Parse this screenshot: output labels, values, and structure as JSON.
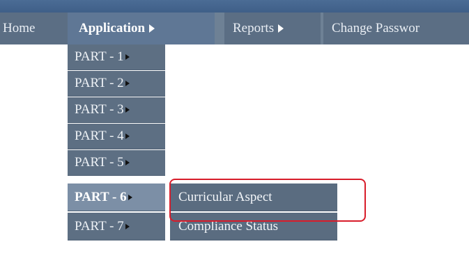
{
  "menubar": {
    "items": [
      {
        "label": "Home",
        "has_arrow": false
      },
      {
        "label": "Application",
        "has_arrow": true
      },
      {
        "label": "Reports",
        "has_arrow": true
      },
      {
        "label": "Change Passwor",
        "has_arrow": false
      }
    ]
  },
  "application_menu": {
    "items": [
      {
        "label": "PART - 1"
      },
      {
        "label": "PART - 2"
      },
      {
        "label": "PART - 3"
      },
      {
        "label": "PART - 4"
      },
      {
        "label": "PART - 5"
      },
      {
        "label": "PART - 6"
      },
      {
        "label": "PART - 7"
      }
    ]
  },
  "part6_submenu": {
    "items": [
      {
        "label": "Curricular Aspect"
      },
      {
        "label": "Compliance Status"
      }
    ]
  },
  "colors": {
    "highlight_box": "#d81c2a"
  }
}
